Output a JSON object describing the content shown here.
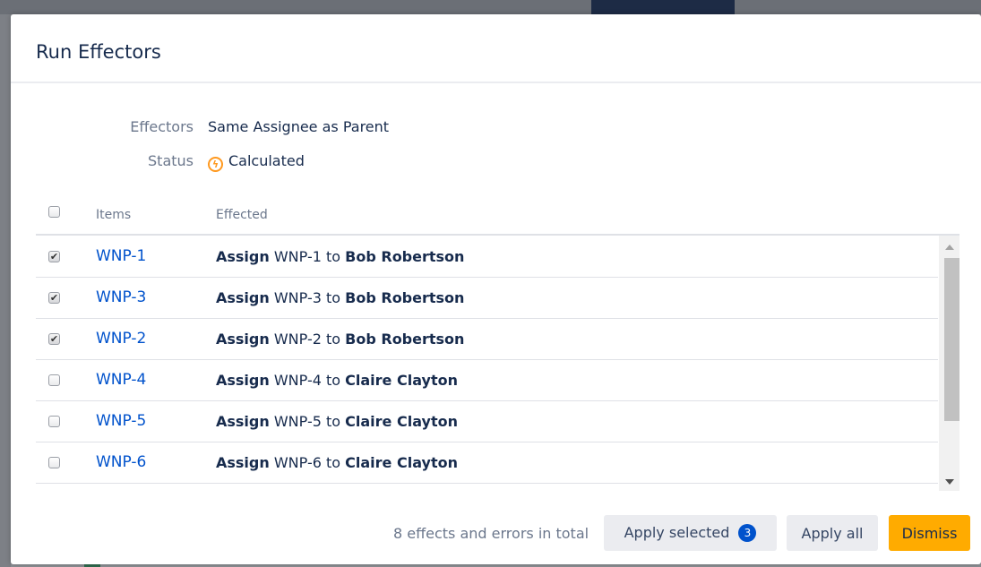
{
  "dialog": {
    "title": "Run Effectors"
  },
  "meta": {
    "effectors_label": "Effectors",
    "effectors_value": "Same Assignee as Parent",
    "status_label": "Status",
    "status_value": "Calculated",
    "status_icon": "lightning-icon"
  },
  "table": {
    "col_items": "Items",
    "col_effected": "Effected",
    "header_checked": false,
    "rows": [
      {
        "checked": true,
        "item": "WNP-1",
        "verb": "Assign",
        "target": "WNP-1",
        "to": "to",
        "assignee": "Bob Robertson"
      },
      {
        "checked": true,
        "item": "WNP-3",
        "verb": "Assign",
        "target": "WNP-3",
        "to": "to",
        "assignee": "Bob Robertson"
      },
      {
        "checked": true,
        "item": "WNP-2",
        "verb": "Assign",
        "target": "WNP-2",
        "to": "to",
        "assignee": "Bob Robertson"
      },
      {
        "checked": false,
        "item": "WNP-4",
        "verb": "Assign",
        "target": "WNP-4",
        "to": "to",
        "assignee": "Claire Clayton"
      },
      {
        "checked": false,
        "item": "WNP-5",
        "verb": "Assign",
        "target": "WNP-5",
        "to": "to",
        "assignee": "Claire Clayton"
      },
      {
        "checked": false,
        "item": "WNP-6",
        "verb": "Assign",
        "target": "WNP-6",
        "to": "to",
        "assignee": "Claire Clayton"
      }
    ]
  },
  "footer": {
    "summary": "8 effects and errors in total",
    "apply_selected_label": "Apply selected",
    "selected_count": "3",
    "apply_all_label": "Apply all",
    "dismiss_label": "Dismiss"
  },
  "colors": {
    "link": "#0052cc",
    "primary_text": "#172b4d",
    "muted_text": "#6b778c",
    "dismiss_bg": "#ffab00",
    "badge_bg": "#0052cc",
    "status_icon": "#ff991f"
  }
}
